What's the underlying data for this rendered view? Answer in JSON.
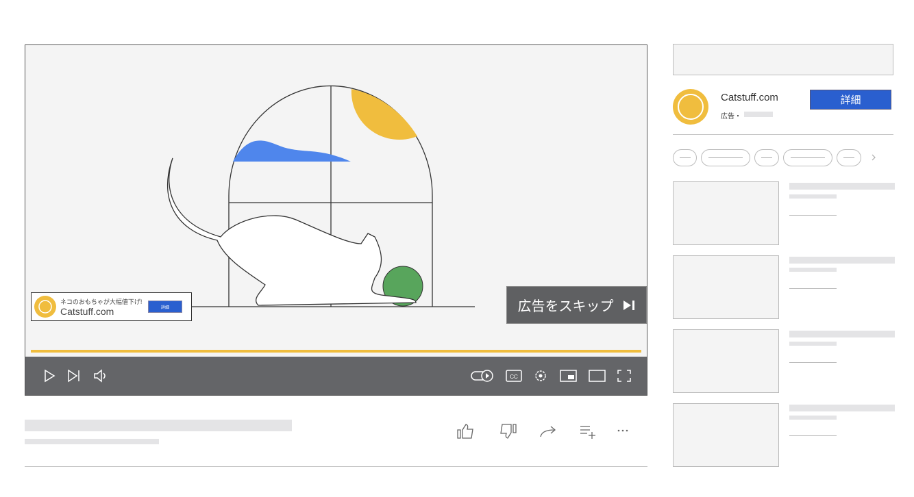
{
  "video": {
    "skip_label": "広告をスキップ",
    "overlay": {
      "promo_text": "ネコのおもちゃが大幅値下げ!",
      "site": "Catstuff.com",
      "button_label": "詳細"
    },
    "progress_percent": 100
  },
  "sidebar_ad": {
    "site": "Catstuff.com",
    "ad_label": "広告・",
    "button_label": "詳細"
  },
  "colors": {
    "accent_blue": "#2a5fcf",
    "brand_yellow": "#f0bd3e",
    "controls_bg": "#646568"
  }
}
